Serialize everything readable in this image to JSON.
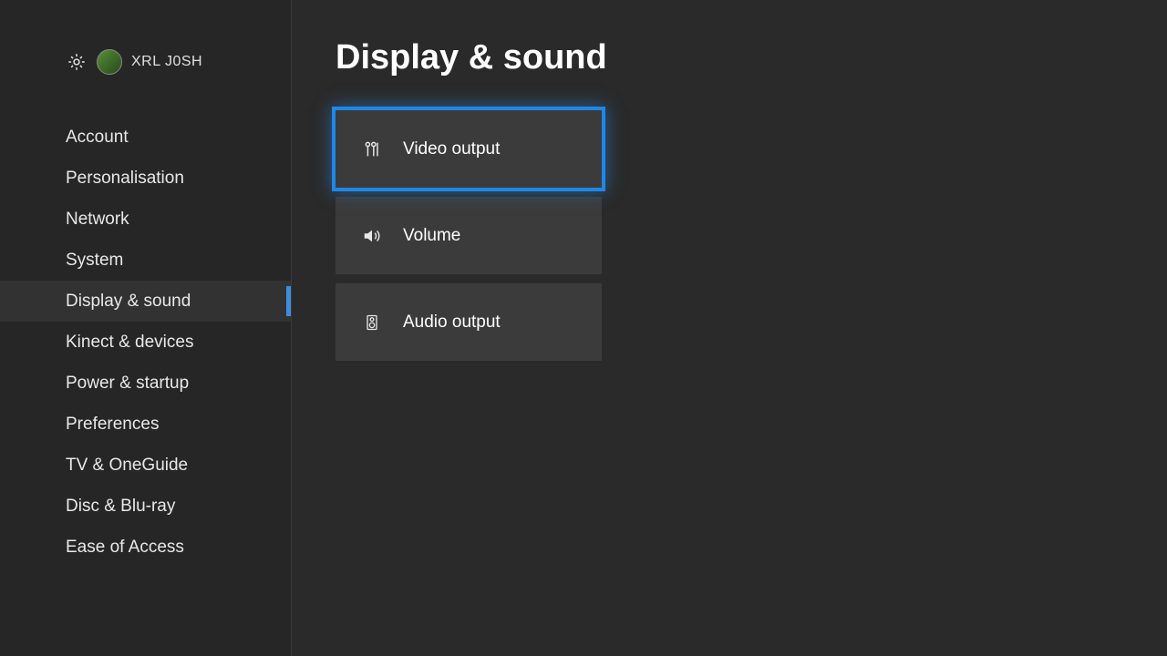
{
  "header": {
    "gamertag": "XRL J0SH"
  },
  "sidebar": {
    "items": [
      {
        "label": "Account"
      },
      {
        "label": "Personalisation"
      },
      {
        "label": "Network"
      },
      {
        "label": "System"
      },
      {
        "label": "Display & sound"
      },
      {
        "label": "Kinect & devices"
      },
      {
        "label": "Power & startup"
      },
      {
        "label": "Preferences"
      },
      {
        "label": "TV & OneGuide"
      },
      {
        "label": "Disc & Blu-ray"
      },
      {
        "label": "Ease of Access"
      }
    ],
    "active_index": 4
  },
  "main": {
    "title": "Display & sound",
    "tiles": [
      {
        "icon": "av-cable-icon",
        "label": "Video output"
      },
      {
        "icon": "speaker-icon",
        "label": "Volume"
      },
      {
        "icon": "audio-jack-icon",
        "label": "Audio output"
      }
    ],
    "selected_index": 0
  },
  "colors": {
    "accent": "#1f87e8",
    "bg_main": "#2a2a2a",
    "bg_sidebar": "#262626",
    "tile": "#3b3b3b"
  }
}
